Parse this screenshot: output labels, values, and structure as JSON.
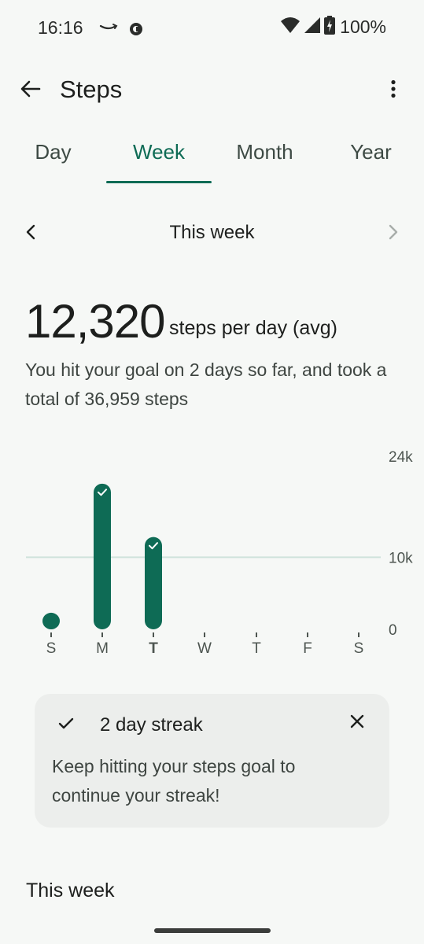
{
  "status_bar": {
    "time": "16:16",
    "battery": "100%",
    "icons": [
      "amazon-smile-icon",
      "sync-circle-icon",
      "wifi-icon",
      "cellular-signal-icon",
      "battery-charging-icon"
    ]
  },
  "app_bar": {
    "title": "Steps",
    "back_icon": "arrow-left-icon",
    "menu_icon": "more-vert-icon"
  },
  "tabs": [
    {
      "label": "Day",
      "selected": false
    },
    {
      "label": "Week",
      "selected": true
    },
    {
      "label": "Month",
      "selected": false
    },
    {
      "label": "Year",
      "selected": false
    }
  ],
  "period": {
    "label": "This week",
    "prev_icon": "chevron-left-icon",
    "next_icon": "chevron-right-icon",
    "next_enabled": false
  },
  "summary": {
    "value": "12,320",
    "unit": "steps per day (avg)",
    "description": "You hit your goal on 2 days so far, and took a total of 36,959 steps"
  },
  "chart_data": {
    "type": "bar",
    "categories": [
      "S",
      "M",
      "T",
      "W",
      "T",
      "F",
      "S"
    ],
    "values": [
      2300,
      20200,
      12800,
      0,
      0,
      0,
      0
    ],
    "goal_met": [
      false,
      true,
      true,
      false,
      false,
      false,
      false
    ],
    "current_index": 2,
    "y_ticks": [
      "24k",
      "10k",
      "0"
    ],
    "ylim": [
      0,
      24000
    ],
    "goal_value": 10000,
    "bar_color": "#0e6b55",
    "goal_line_color": "#cfe3dc"
  },
  "streak_card": {
    "title": "2 day streak",
    "body": "Keep hitting your steps goal to continue your streak!",
    "check_icon": "check-icon",
    "close_icon": "close-icon"
  },
  "section": {
    "title": "This week"
  },
  "colors": {
    "accent": "#0e6b55",
    "background": "#f6f8f6",
    "card": "#eceeec"
  }
}
